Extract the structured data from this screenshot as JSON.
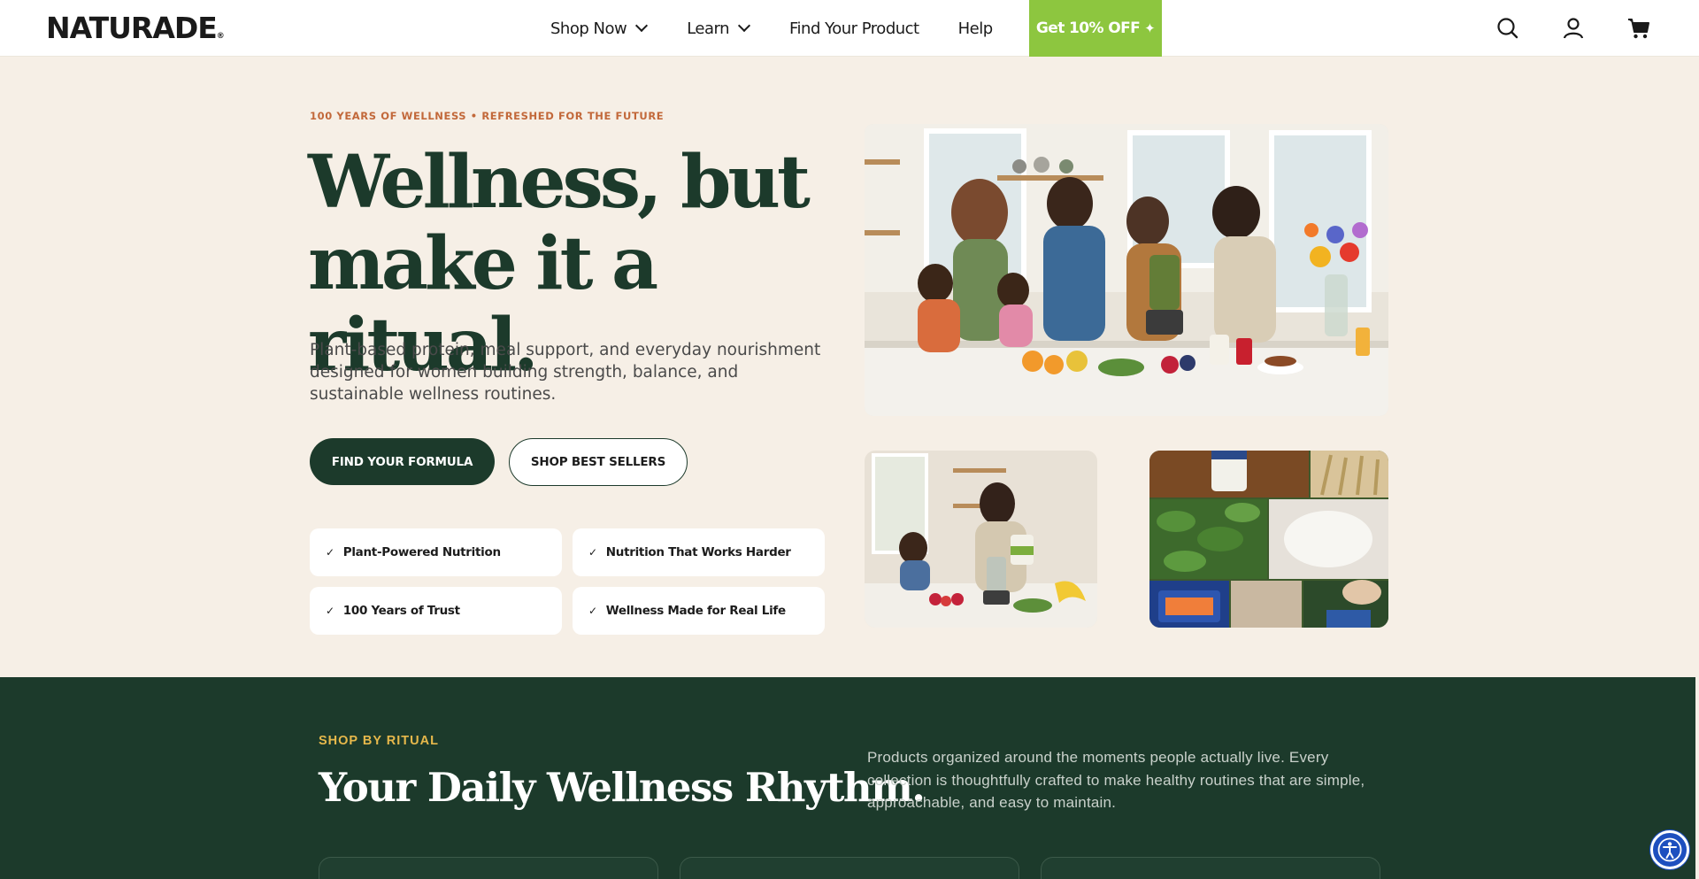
{
  "header": {
    "logo_text": "NATURADE",
    "logo_mark": "®",
    "nav": {
      "shop_now": "Shop Now",
      "learn": "Learn",
      "find_product": "Find Your Product",
      "help": "Help"
    },
    "promo_label": "Get 10% OFF",
    "promo_icon": "sparkle-icon",
    "icons": [
      "search-icon",
      "account-icon",
      "cart-icon"
    ]
  },
  "hero": {
    "eyebrow": "100 YEARS OF WELLNESS • REFRESHED FOR THE FUTURE",
    "title_line1": "Wellness, but",
    "title_line2": "make it a ritual.",
    "subtitle": "Plant-based protein, meal support, and everyday nourishment designed for women building strength, balance, and sustainable wellness routines.",
    "primary_button": "FIND YOUR FORMULA",
    "secondary_button": "SHOP BEST SELLERS",
    "features": [
      "Plant-Powered Nutrition",
      "Nutrition That Works Harder",
      "100 Years of Trust",
      "Wellness Made for Real Life"
    ],
    "check_glyph": "✓"
  },
  "ritual": {
    "eyebrow": "SHOP BY RITUAL",
    "title": "Your Daily Wellness Rhythm.",
    "description": "Products organized around the moments people actually live. Every collection is thoughtfully crafted to make healthy routines that are simple, approachable, and easy to maintain."
  },
  "colors": {
    "brand_green": "#1c3a2b",
    "promo_green": "#8dc63f",
    "eyebrow_orange": "#c2683a",
    "ritual_gold": "#e6b84b",
    "page_cream": "#f6efe6"
  },
  "accessibility_widget": "accessibility-icon"
}
